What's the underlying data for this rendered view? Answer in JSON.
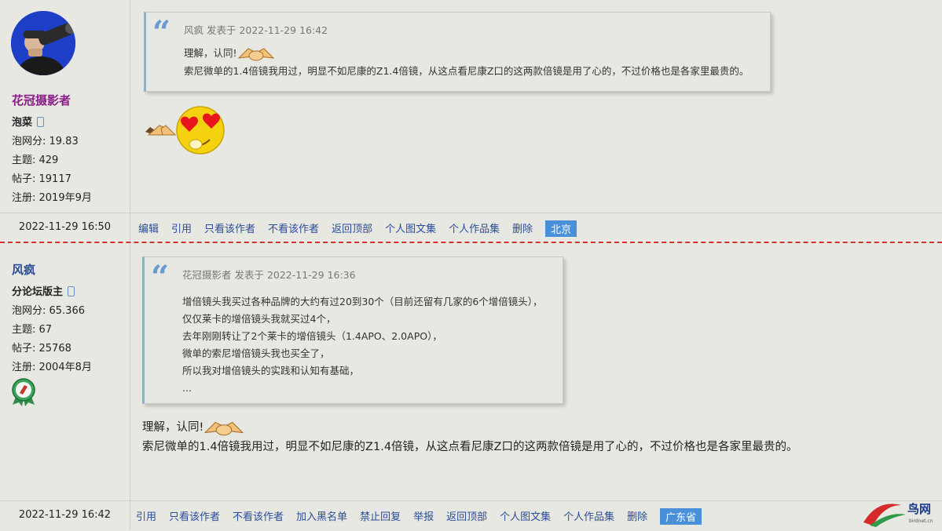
{
  "posts": [
    {
      "author": {
        "name": "花冠摄影者",
        "rank": "泡菜",
        "score": "泡网分: 19.83",
        "topics": "主题: 429",
        "posts": "帖子: 19117",
        "registered": "注册: 2019年9月"
      },
      "quote": {
        "header": "风疯 发表于 2022-11-29 16:42",
        "lines": [
          "理解，认同!",
          "索尼微单的1.4倍镜我用过，明显不如尼康的Z1.4倍镜，从这点看尼康Z口的这两款倍镜是用了心的，不过价格也是各家里最贵的。"
        ]
      },
      "footer": {
        "date": "2022-11-29 16:50",
        "actions": [
          "编辑",
          "引用",
          "只看该作者",
          "不看该作者",
          "返回顶部",
          "个人图文集",
          "个人作品集",
          "删除"
        ],
        "location": "北京"
      }
    },
    {
      "author": {
        "name": "风疯",
        "rank": "分论坛版主",
        "score": "泡网分: 65.366",
        "topics": "主题: 67",
        "posts": "帖子: 25768",
        "registered": "注册: 2004年8月"
      },
      "quote": {
        "header": "花冠摄影者 发表于 2022-11-29 16:36",
        "lines": [
          "增倍镜头我买过各种品牌的大约有过20到30个（目前还留有几家的6个增倍镜头），",
          "仅仅莱卡的增倍镜头我就买过4个，",
          "去年刚刚转让了2个莱卡的增倍镜头（1.4APO、2.0APO），",
          "微单的索尼增倍镜头我也买全了，",
          "所以我对增倍镜头的实践和认知有基础，",
          "..."
        ]
      },
      "body": {
        "line1": "理解，认同!",
        "line2": "索尼微单的1.4倍镜我用过，明显不如尼康的Z1.4倍镜，从这点看尼康Z口的这两款倍镜是用了心的，不过价格也是各家里最贵的。"
      },
      "footer": {
        "date": "2022-11-29 16:42",
        "actions": [
          "引用",
          "只看该作者",
          "不看该作者",
          "加入黑名单",
          "禁止回复",
          "举报",
          "返回顶部",
          "个人图文集",
          "个人作品集",
          "删除"
        ],
        "location": "广东省"
      }
    }
  ],
  "watermark": {
    "cn": "鸟网",
    "url": "birdnet.cn"
  },
  "colors": {
    "link": "#2a4c9a",
    "location_badge": "#4a90d9",
    "divider": "#d43030"
  }
}
